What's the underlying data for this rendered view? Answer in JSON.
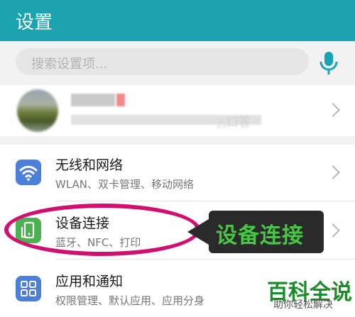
{
  "header": {
    "title": "设置",
    "bg": "#1ba3b2"
  },
  "search": {
    "placeholder": "搜索设置项..."
  },
  "account": {
    "subtitle_fragment": "△口答"
  },
  "items": [
    {
      "title": "无线和网络",
      "subtitle": "WLAN、双卡管理、移动网络",
      "icon": "wifi-icon",
      "color": "#4b7fd8"
    },
    {
      "title": "设备连接",
      "subtitle": "蓝牙、NFC、打印",
      "icon": "device-connect-icon",
      "color": "#4caf50"
    },
    {
      "title": "应用和通知",
      "subtitle": "权限管理、默认应用、应用分身",
      "icon": "apps-grid-icon",
      "color": "#4b7fd8"
    }
  ],
  "annotation": {
    "label": "设备连接",
    "ring_color": "#d10f6e",
    "label_color": "#45c844"
  },
  "watermark": {
    "title": "百科全说",
    "subtitle": "助你轻松解决"
  }
}
